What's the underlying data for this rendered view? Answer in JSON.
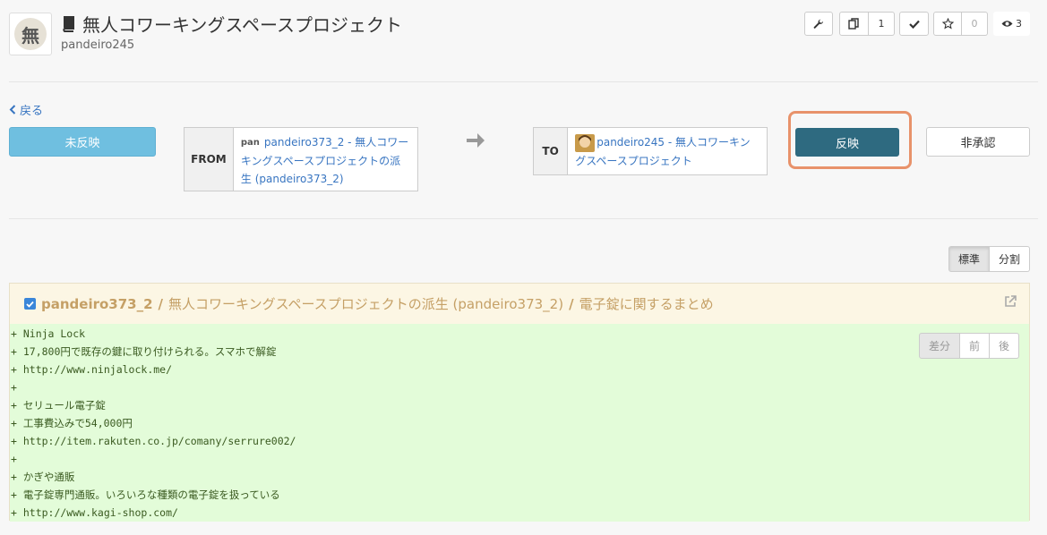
{
  "header": {
    "avatar_text": "無",
    "title": "無人コワーキングスペースプロジェクト",
    "owner": "pandeiro245",
    "fork_count": "1",
    "star_count": "0",
    "watch_count": "3"
  },
  "nav": {
    "back_label": "戻る"
  },
  "pull_request": {
    "status_label": "未反映",
    "from_label": "FROM",
    "from_avatar_text": "pan",
    "from_text": "pandeiro373_2 - 無人コワーキングスペースプロジェクトの派生 (pandeiro373_2)",
    "to_label": "TO",
    "to_text": "pandeiro245 - 無人コワーキングスペースプロジェクト",
    "apply_label": "反映",
    "reject_label": "非承認"
  },
  "view_toggle": {
    "standard": "標準",
    "split": "分割"
  },
  "diff": {
    "user": "pandeiro373_2",
    "sep": "/",
    "project": "無人コワーキングスペースプロジェクトの派生 (pandeiro373_2)",
    "page": "電子錠に関するまとめ",
    "nav": {
      "diff": "差分",
      "before": "前",
      "after": "後"
    },
    "lines": [
      "+ Ninja Lock",
      "+ 17,800円で既存の鍵に取り付けられる。スマホで解錠",
      "+ http://www.ninjalock.me/",
      "+",
      "+ セリュール電子錠",
      "+ 工事費込みで54,000円",
      "+ http://item.rakuten.co.jp/comany/serrure002/",
      "+",
      "+ かぎや通販",
      "+ 電子錠専門通販。いろいろな種類の電子錠を扱っている",
      "+ http://www.kagi-shop.com/"
    ]
  },
  "colors": {
    "accent": "#2e6a80",
    "status": "#6fbfe0",
    "link": "#3875c1",
    "highlight": "#e8926a",
    "diff_bg": "#e3fcd9"
  }
}
